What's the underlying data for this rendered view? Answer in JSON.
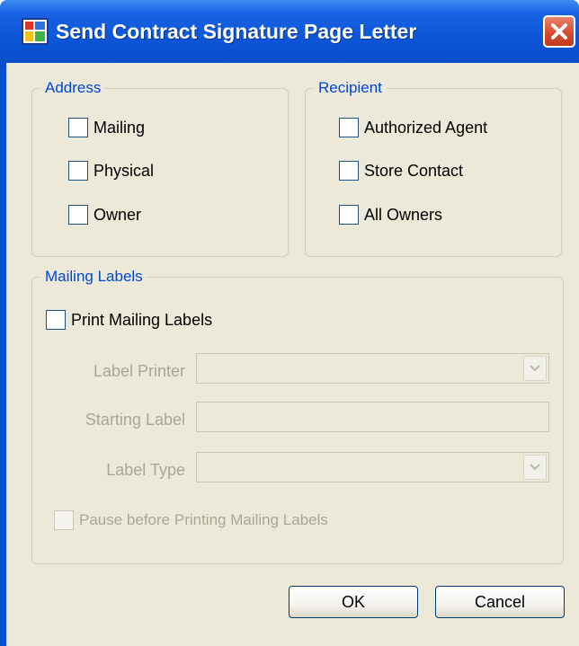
{
  "window": {
    "title": "Send Contract Signature Page Letter",
    "app_icon": "form-icon",
    "close_icon": "close-icon"
  },
  "address": {
    "legend": "Address",
    "options": [
      "Mailing",
      "Physical",
      "Owner"
    ]
  },
  "recipient": {
    "legend": "Recipient",
    "options": [
      "Authorized Agent",
      "Store Contact",
      "All Owners"
    ]
  },
  "mailing_labels": {
    "legend": "Mailing Labels",
    "print_label": "Print Mailing Labels",
    "label_printer_label": "Label Printer",
    "label_printer_value": "",
    "starting_label_label": "Starting Label",
    "starting_label_value": "",
    "label_type_label": "Label Type",
    "label_type_value": "",
    "pause_label": "Pause before Printing Mailing Labels"
  },
  "buttons": {
    "ok": "OK",
    "cancel": "Cancel"
  },
  "colors": {
    "titlebar": "#0a4fd0",
    "dialog_bg": "#ece9d8",
    "group_legend": "#0046d5",
    "disabled_text": "#a8a794",
    "close_button": "#d5492b"
  }
}
